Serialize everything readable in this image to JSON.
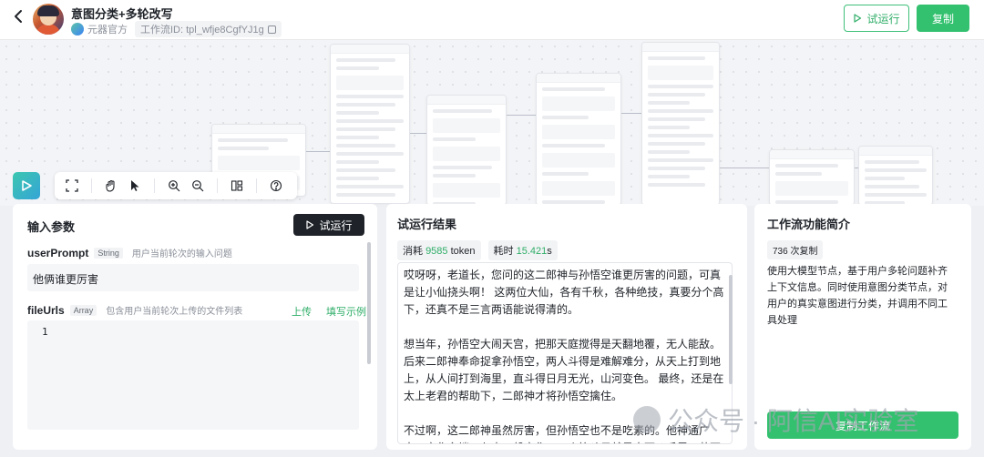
{
  "header": {
    "title": "意图分类+多轮改写",
    "org": "元器官方",
    "workflow_id": "工作流ID: tpl_wfje8CgfYJ1g",
    "try_run_label": "试运行",
    "copy_label": "复制"
  },
  "input_panel": {
    "title": "输入参数",
    "run_label": "试运行",
    "params": [
      {
        "name": "userPrompt",
        "type": "String",
        "desc": "用户当前轮次的输入问题",
        "value": "他俩谁更厉害"
      },
      {
        "name": "fileUrls",
        "type": "Array",
        "desc": "包含用户当前轮次上传的文件列表",
        "upload_label": "上传",
        "example_label": "填写示例",
        "line_number": "1"
      }
    ]
  },
  "result_panel": {
    "title": "试运行结果",
    "token_label": "消耗",
    "token_value": "9585",
    "token_unit": "token",
    "time_label": "耗时",
    "time_value": "15.421",
    "time_unit": "s",
    "paragraphs": [
      "哎呀呀，老道长，您问的这二郎神与孙悟空谁更厉害的问题，可真是让小仙挠头啊！  这两位大仙，各有千秋，各种绝技，真要分个高下，还真不是三言两语能说得清的。",
      "想当年，孙悟空大闹天宫，把那天庭搅得是天翻地覆，无人能敌。后来二郎神奉命捉拿孙悟空，两人斗得是难解难分，从天上打到地上，从人间打到海里，直斗得日月无光，山河变色。   最终，还是在太上老君的帮助下，二郎神才将孙悟空擒住。",
      "不过啊，这二郎神虽然厉害，但孙悟空也不是吃素的。他神通广大，变化多端，七十二般变化，一个筋斗云就是十万八千里。若不是被太上老君偷袭，孙悟空还真未必会被擒住。"
    ]
  },
  "intro_panel": {
    "title": "工作流功能简介",
    "copy_count": "736 次复制",
    "description": "使用大模型节点，基于用户多轮问题补齐上下文信息。同时使用意图分类节点，对用户的真实意图进行分类，并调用不同工具处理",
    "copy_flow_label": "复制工作流"
  },
  "watermark": {
    "text": "公众号 · 阿信AI实验室"
  }
}
